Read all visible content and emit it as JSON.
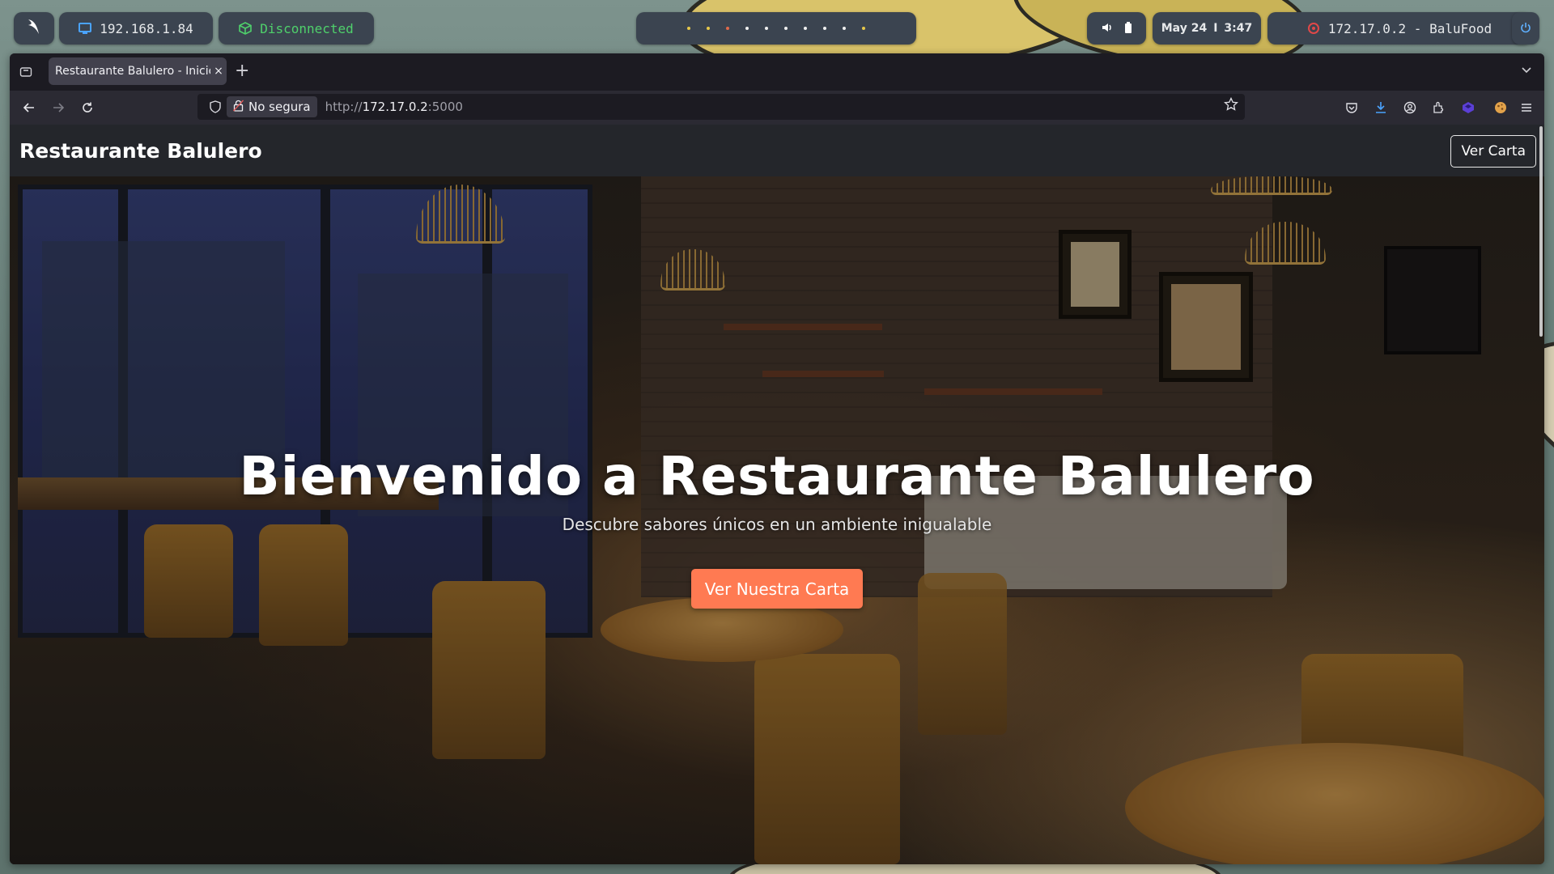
{
  "topbar": {
    "ip": "192.168.1.84",
    "vpn_status": "Disconnected",
    "workspace_dot_colors": [
      "#e7c84a",
      "#e7c84a",
      "#e06a4a",
      "#f0f0f0",
      "#f0f0f0",
      "#f0f0f0",
      "#f0f0f0",
      "#f0f0f0",
      "#f0f0f0",
      "#e7c84a"
    ],
    "date": "May 24",
    "separator": "I",
    "time": "3:47",
    "target": "172.17.0.2 - BaluFood"
  },
  "browser": {
    "tab_title": "Restaurante Balulero - Inicio",
    "tab_close": "×",
    "new_tab": "+",
    "security_label": "No segura",
    "url_prefix": "http://",
    "url_host": "172.17.0.2",
    "url_suffix": ":5000"
  },
  "site": {
    "brand": "Restaurante Balulero",
    "nav_button": "Ver Carta",
    "hero_title": "Bienvenido a Restaurante Balulero",
    "hero_subtitle": "Descubre sabores únicos en un ambiente inigualable",
    "cta_label": "Ver Nuestra Carta",
    "accent_color": "#ff7a52"
  },
  "icons": [
    "arch-logo-icon",
    "monitor-icon",
    "cube-icon",
    "speaker-icon",
    "battery-icon",
    "target-icon",
    "power-icon",
    "sidebar-icon",
    "chevron-down-icon",
    "back-icon",
    "forward-icon",
    "reload-icon",
    "shield-icon",
    "lock-icon",
    "star-icon",
    "pocket-icon",
    "download-icon",
    "account-icon",
    "extensions-icon",
    "extension-purple-icon",
    "extension-cookie-icon",
    "menu-icon"
  ]
}
